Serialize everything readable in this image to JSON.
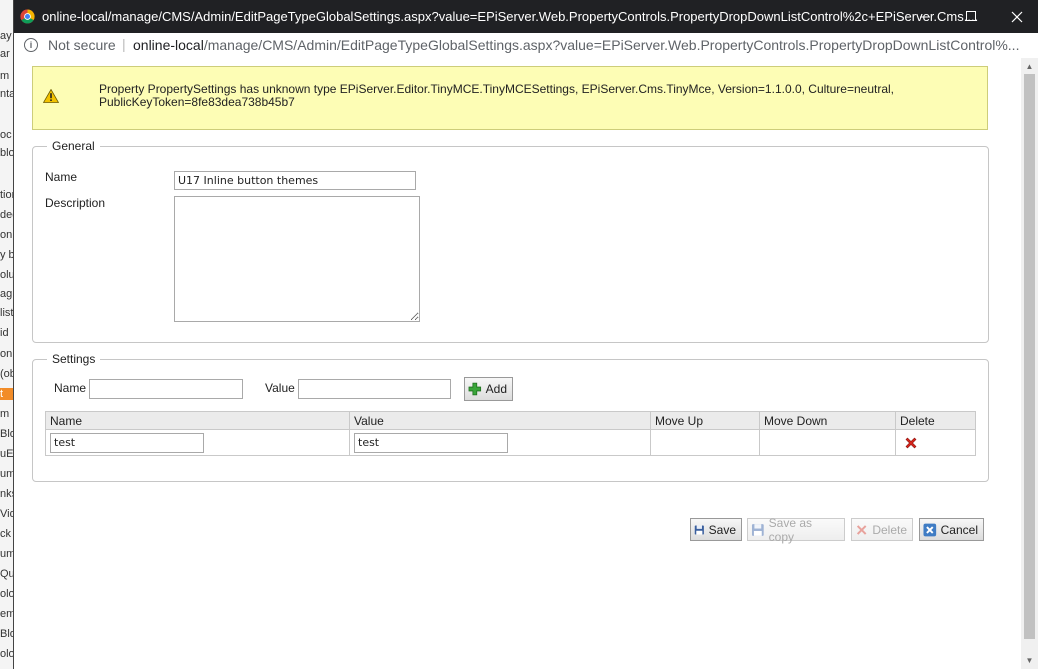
{
  "background_app": {
    "fragments": [
      "ay",
      "ar",
      "m",
      "nta",
      "oc",
      "blo",
      "tion",
      "deg",
      "onL",
      "y b",
      "olu",
      "ag",
      "list",
      "id",
      "on",
      "(ob",
      "t",
      "m",
      "Blo",
      "uE",
      "um",
      "nks",
      "Vid",
      "ck",
      "um",
      "Qu",
      "olo",
      "em",
      "Blo",
      "olo"
    ]
  },
  "browser": {
    "window_title": "online-local/manage/CMS/Admin/EditPageTypeGlobalSettings.aspx?value=EPiServer.Web.PropertyControls.PropertyDropDownListControl%2c+EPiServer.Cms....",
    "not_secure": "Not secure",
    "url_host": "online-local",
    "url_path": "/manage/CMS/Admin/EditPageTypeGlobalSettings.aspx?value=EPiServer.Web.PropertyControls.PropertyDropDownListControl%..."
  },
  "warning": {
    "message": "Property PropertySettings has unknown type EPiServer.Editor.TinyMCE.TinyMCESettings, EPiServer.Cms.TinyMce, Version=1.1.0.0, Culture=neutral, PublicKeyToken=8fe83dea738b45b7"
  },
  "general": {
    "legend": "General",
    "name_label": "Name",
    "name_value": "U17 Inline button themes",
    "description_label": "Description",
    "description_value": ""
  },
  "settings": {
    "legend": "Settings",
    "name_label": "Name",
    "value_label": "Value",
    "name_input": "",
    "value_input": "",
    "add_label": "Add",
    "columns": [
      "Name",
      "Value",
      "Move Up",
      "Move Down",
      "Delete"
    ],
    "rows": [
      {
        "name": "test",
        "value": "test"
      }
    ]
  },
  "actions": {
    "save": "Save",
    "save_as_copy": "Save as copy",
    "delete": "Delete",
    "cancel": "Cancel"
  },
  "colors": {
    "title_bar": "#202124",
    "warning_bg": "#fdfdb5",
    "delete_red": "#d9261c",
    "add_green": "#3aa53a"
  }
}
